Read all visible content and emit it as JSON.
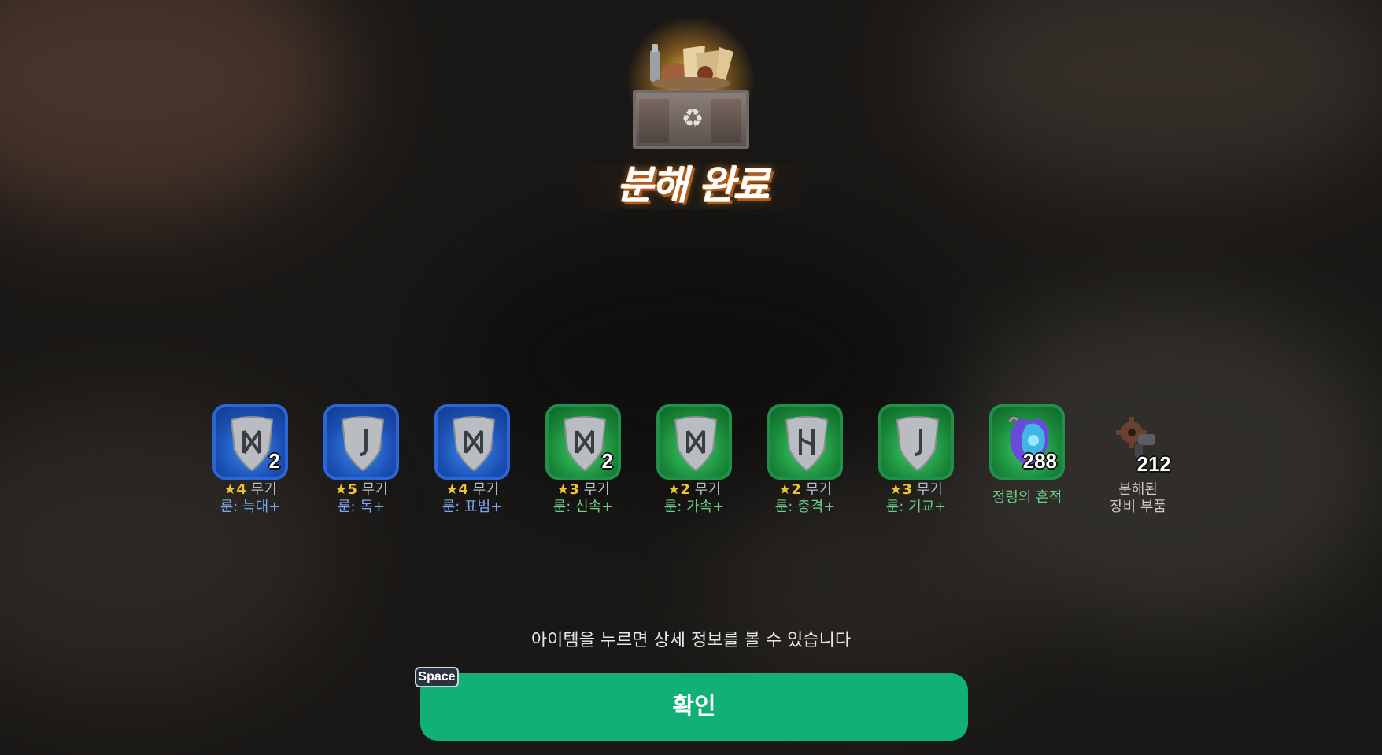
{
  "title": "분해 완료",
  "hint": "아이템을 누르면 상세 정보를 볼 수 있습니다",
  "confirm": {
    "label": "확인",
    "key": "Space"
  },
  "rewards": [
    {
      "rarity": "blue",
      "qty": "2",
      "grade": "★4",
      "type": "무기",
      "rune": "룬: 늑대+"
    },
    {
      "rarity": "blue",
      "qty": "",
      "grade": "★5",
      "type": "무기",
      "rune": "룬: 독+"
    },
    {
      "rarity": "blue",
      "qty": "",
      "grade": "★4",
      "type": "무기",
      "rune": "룬: 표범+"
    },
    {
      "rarity": "green",
      "qty": "2",
      "grade": "★3",
      "type": "무기",
      "rune": "룬: 신속+"
    },
    {
      "rarity": "green",
      "qty": "",
      "grade": "★2",
      "type": "무기",
      "rune": "룬: 가속+"
    },
    {
      "rarity": "green",
      "qty": "",
      "grade": "★2",
      "type": "무기",
      "rune": "룬: 충격+"
    },
    {
      "rarity": "green",
      "qty": "",
      "grade": "★3",
      "type": "무기",
      "rune": "룬: 기교+"
    },
    {
      "rarity": "green",
      "qty": "288",
      "name": "정령의 흔적"
    },
    {
      "rarity": "none",
      "qty": "212",
      "name_line1": "분해된",
      "name_line2": "장비 부품"
    }
  ],
  "icons": {
    "chest": "recycle-chest-icon",
    "rune": "rune-stone-icon",
    "spirit": "spirit-trace-icon",
    "parts": "gear-parts-icon"
  },
  "colors": {
    "confirm_button": "#10b077",
    "blue_tile": "#2a66d6",
    "green_tile": "#20904a",
    "star": "#f2c230"
  }
}
